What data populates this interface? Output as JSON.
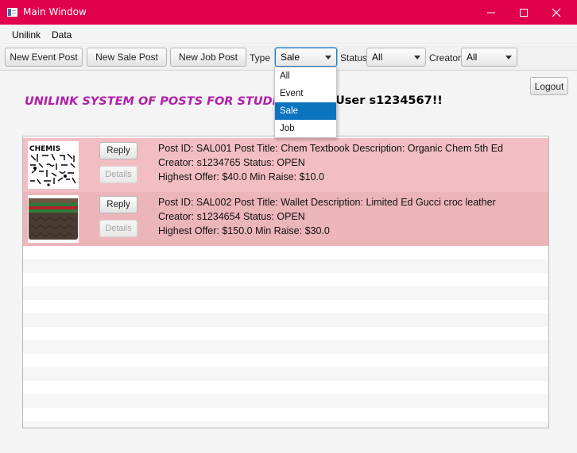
{
  "window": {
    "title": "Main Window"
  },
  "menu": [
    {
      "label": "Unilink"
    },
    {
      "label": "Data"
    }
  ],
  "toolbar": {
    "new_event": "New Event Post",
    "new_sale": "New Sale Post",
    "new_job": "New Job Post",
    "type_label": "Type",
    "type_value": "Sale",
    "status_label": "Status",
    "status_value": "All",
    "creator_label": "Creator",
    "creator_value": "All"
  },
  "type_options": [
    "All",
    "Event",
    "Sale",
    "Job"
  ],
  "type_selected_index": 2,
  "heading": "UNILINK SYSTEM OF POSTS FOR STUDENTS",
  "welcome": "User s1234567!!",
  "logout": "Logout",
  "posts": [
    {
      "line1": "Post ID: SAL001  Post Title: Chem Textbook   Description: Organic Chem 5th Ed",
      "line2": "Creator: s1234765   Status: OPEN",
      "line3": "Highest Offer: $40.0    Min Raise: $10.0",
      "reply": "Reply",
      "details": "Details"
    },
    {
      "line1": "Post ID: SAL002  Post Title: Wallet   Description: Limited Ed Gucci croc leather",
      "line2": "Creator: s1234654   Status: OPEN",
      "line3": "Highest Offer: $150.0    Min Raise: $30.0",
      "reply": "Reply",
      "details": "Details"
    }
  ],
  "colors": {
    "titlebar": "#e0004b",
    "heading": "#b11fa8",
    "row": "#f2bec3",
    "selection": "#0c73bf"
  }
}
